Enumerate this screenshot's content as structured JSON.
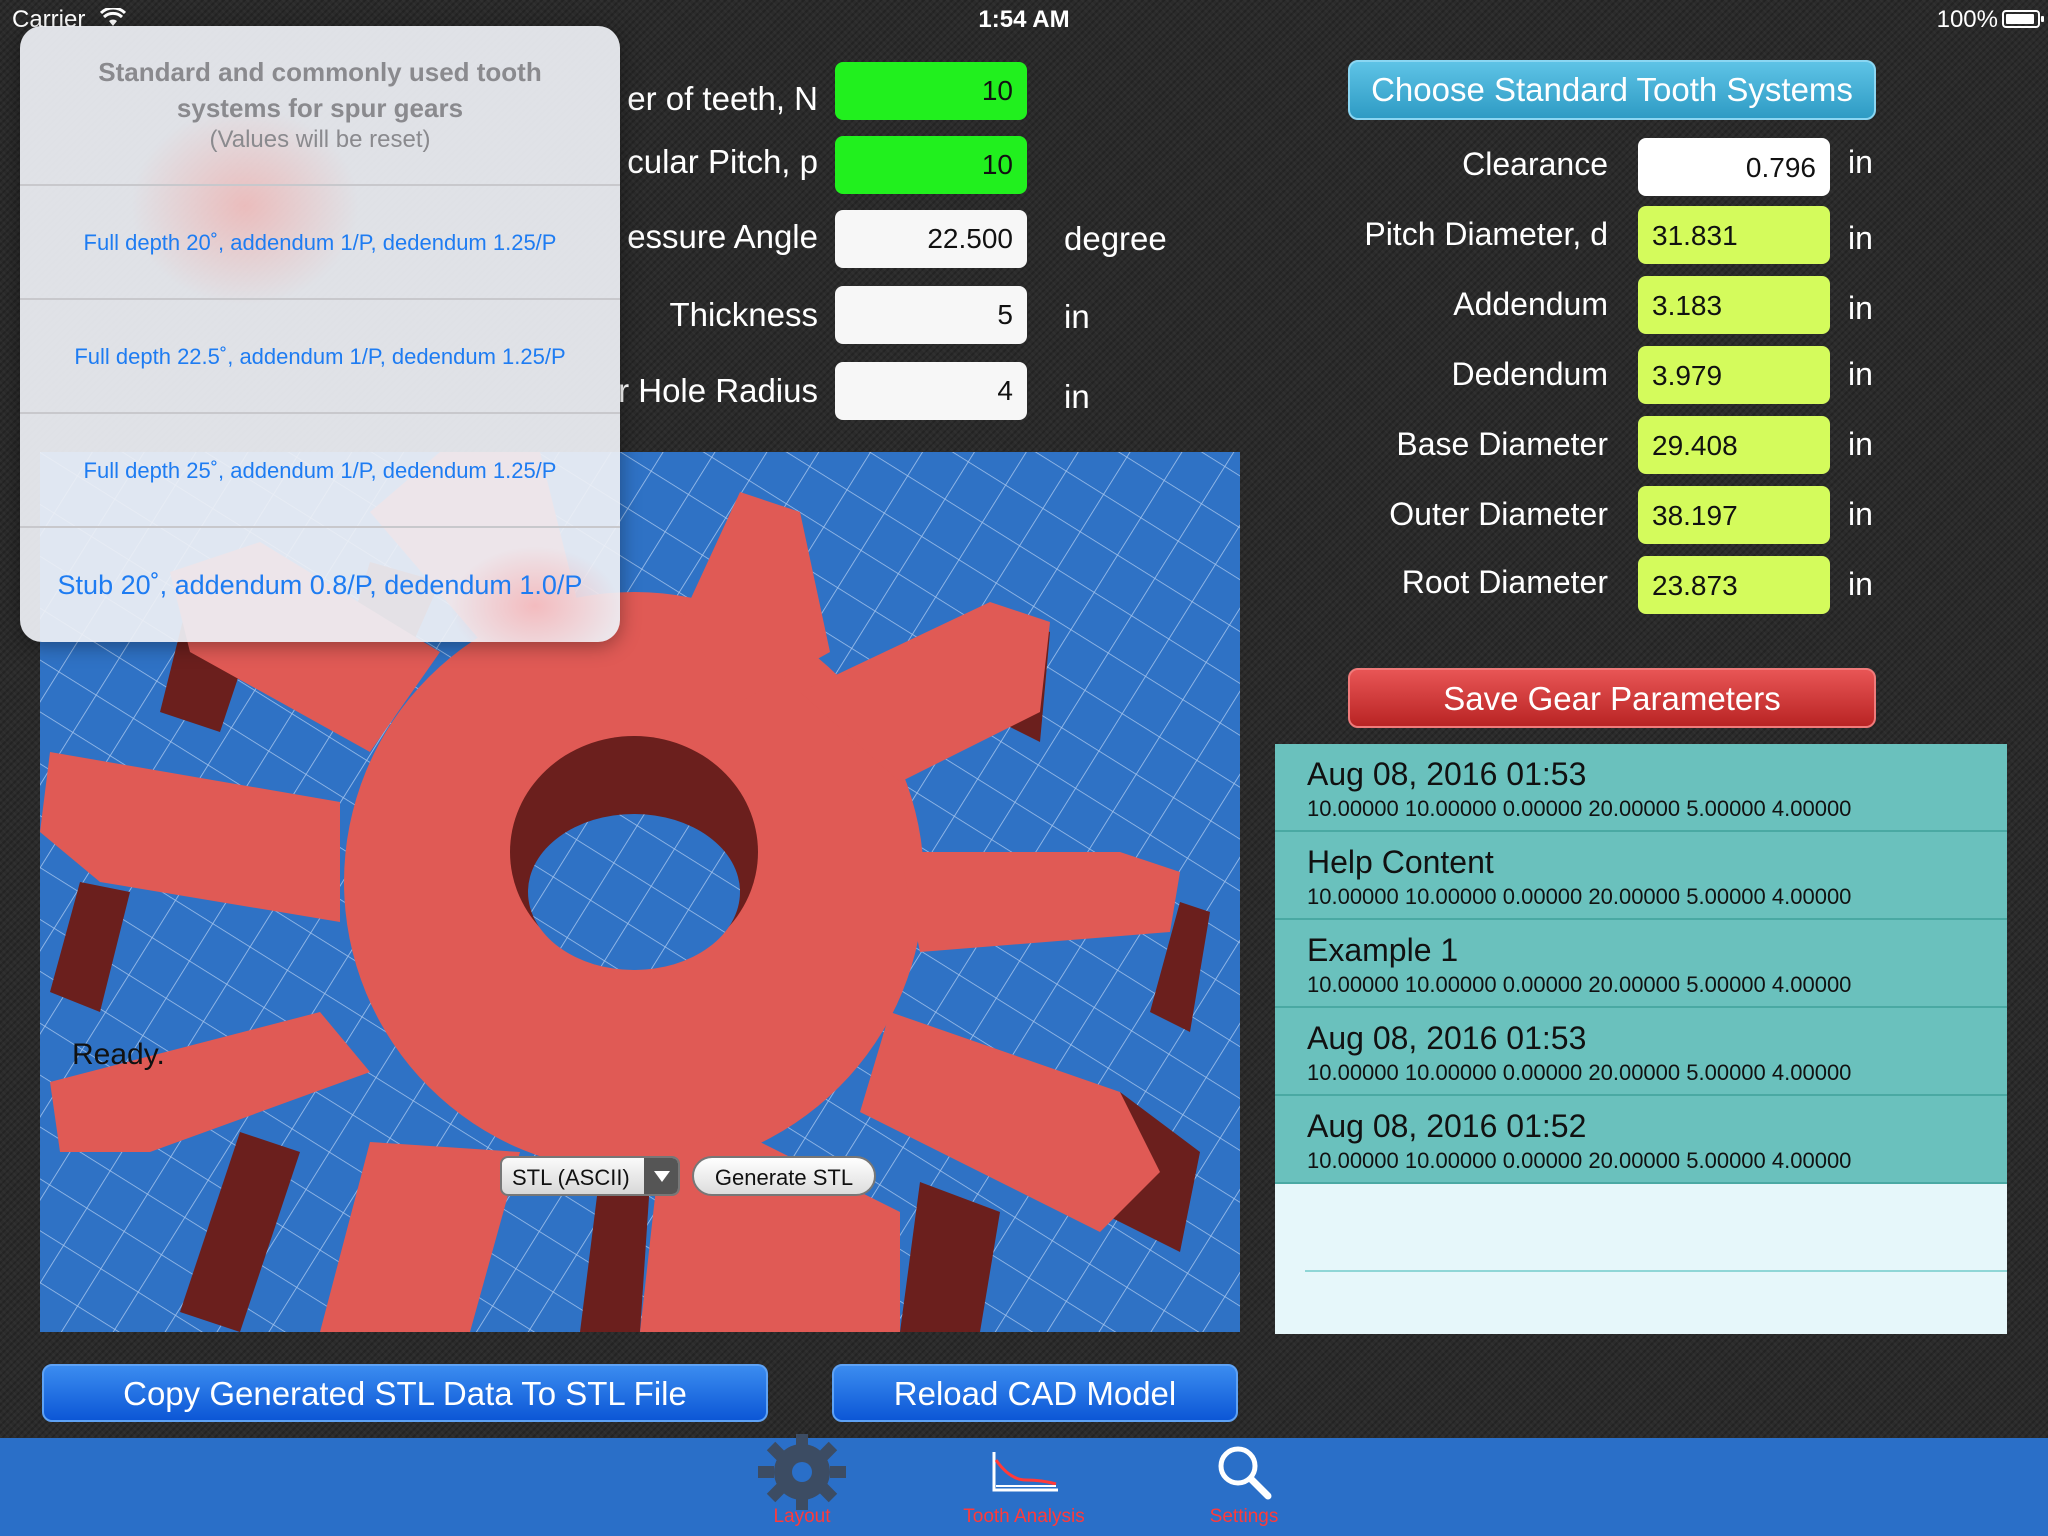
{
  "status_bar": {
    "carrier": "Carrier",
    "time": "1:54 AM",
    "battery": "100%"
  },
  "form": {
    "fields": [
      {
        "label": "er of teeth, N",
        "value": "10",
        "unit": ""
      },
      {
        "label": "cular Pitch, p",
        "value": "10",
        "unit": ""
      },
      {
        "label": "essure Angle",
        "value": "22.500",
        "unit": "degree"
      },
      {
        "label": "Thickness",
        "value": "5",
        "unit": "in"
      },
      {
        "label": "r Hole Radius",
        "value": "4",
        "unit": "in"
      }
    ]
  },
  "results": {
    "choose_button": "Choose Standard Tooth Systems",
    "clearance": {
      "label": "Clearance",
      "value": "0.796",
      "unit": "in"
    },
    "rows": [
      {
        "label": "Pitch Diameter, d",
        "value": "31.831",
        "unit": "in"
      },
      {
        "label": "Addendum",
        "value": "3.183",
        "unit": "in"
      },
      {
        "label": "Dedendum",
        "value": "3.979",
        "unit": "in"
      },
      {
        "label": "Base Diameter",
        "value": "29.408",
        "unit": "in"
      },
      {
        "label": "Outer Diameter",
        "value": "38.197",
        "unit": "in"
      },
      {
        "label": "Root Diameter",
        "value": "23.873",
        "unit": "in"
      }
    ],
    "save_button": "Save Gear Parameters"
  },
  "saved": {
    "items": [
      {
        "title": "Aug 08, 2016 01:53",
        "params": "10.00000 10.00000 0.00000 20.00000 5.00000 4.00000"
      },
      {
        "title": "Help Content",
        "params": "10.00000 10.00000 0.00000 20.00000 5.00000 4.00000"
      },
      {
        "title": "Example 1",
        "params": "10.00000 10.00000 0.00000 20.00000 5.00000 4.00000"
      },
      {
        "title": "Aug 08, 2016 01:53",
        "params": "10.00000 10.00000 0.00000 20.00000 5.00000 4.00000"
      },
      {
        "title": "Aug 08, 2016 01:52",
        "params": "10.00000 10.00000 0.00000 20.00000 5.00000 4.00000"
      }
    ]
  },
  "viewport": {
    "status": "Ready.",
    "format": "STL (ASCII)",
    "generate_button": "Generate STL",
    "gear_color": "#e05a55",
    "background_color": "#2f72c5"
  },
  "bottom_buttons": {
    "copy": "Copy Generated STL Data To STL File",
    "reload": "Reload CAD Model"
  },
  "tabs": [
    {
      "label": "Layout",
      "icon": "gear-icon"
    },
    {
      "label": "Tooth Analysis",
      "icon": "chart-icon"
    },
    {
      "label": "Settings",
      "icon": "search-icon"
    }
  ],
  "popover": {
    "title": "Standard and commonly used tooth systems for spur gears",
    "note": "(Values will be reset)",
    "options": [
      "Full depth 20˚, addendum 1/P, dedendum 1.25/P",
      "Full depth 22.5˚, addendum 1/P, dedendum 1.25/P",
      "Full depth 25˚, addendum 1/P, dedendum 1.25/P",
      "Stub 20˚, addendum 0.8/P, dedendum 1.0/P"
    ]
  }
}
